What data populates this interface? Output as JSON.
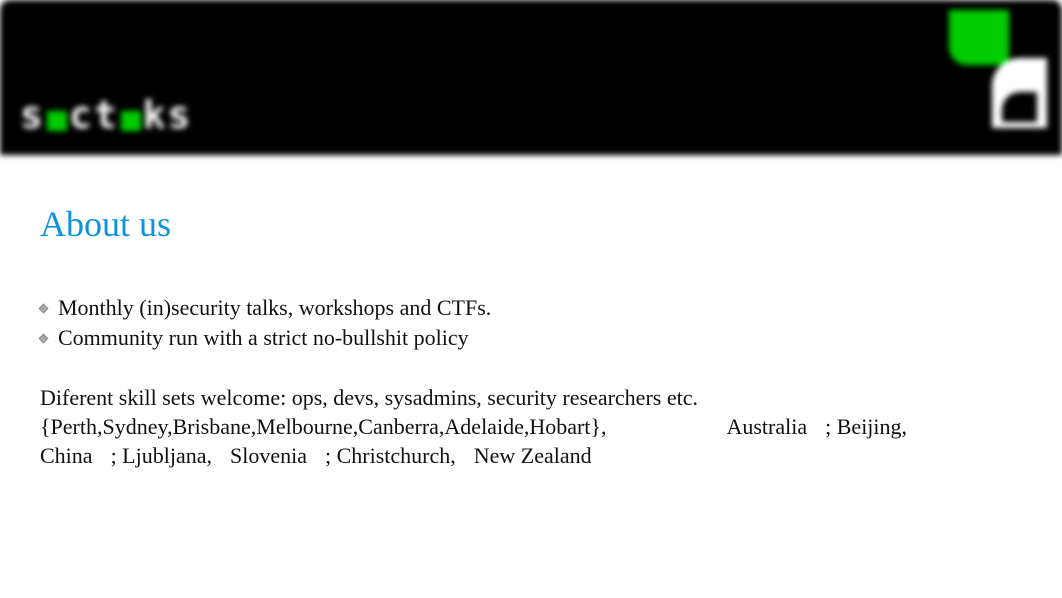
{
  "header": {
    "brand_left_segments": [
      "s",
      "c",
      "t",
      "a",
      "ks"
    ],
    "logo_style": "green-accent"
  },
  "page": {
    "title": "About us"
  },
  "bullets": [
    "Monthly (in)security talks, workshops and CTFs.",
    "Community run with a strict no-bullshit policy"
  ],
  "body": {
    "line1": "Diferent skill sets welcome: ops, devs, sysadmins, security researchers etc.",
    "line2_cities": "{Perth,Sydney,Brisbane,Melbourne,Canberra,Adelaide,Hobart},",
    "line2_country": "Australia",
    "line2_sep": "; Beijing,",
    "line3_china": "China",
    "line3_ljubljana": "; Ljubljana,",
    "line3_slovenia": "Slovenia",
    "line3_christchurch": "; Christchurch,",
    "line3_nz": "New Zealand"
  }
}
